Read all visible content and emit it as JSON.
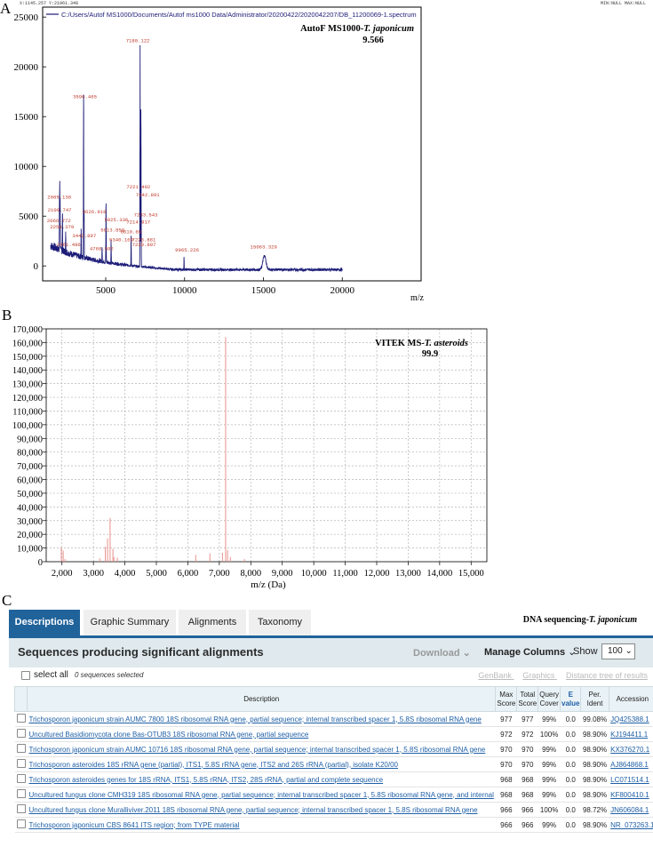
{
  "panels": {
    "a": "A",
    "b": "B",
    "c": "C"
  },
  "chart_data": [
    {
      "type": "line",
      "panel": "A",
      "top_status": {
        "left": "X:1145.257  Y:21961.348",
        "right": "MIN:NULL  MAX:NULL"
      },
      "legend": "C:/Users/Autof MS1000/Documents/Autof ms1000 Data/Administrator/20200422/2020042207/DB_11200069-1.spectrum",
      "annotation": {
        "line1": "AutoF MS1000-",
        "species": "T. japonicum",
        "line2": "9.566"
      },
      "xlabel": "m/z",
      "ylabel": "",
      "xlim": [
        1000,
        25000
      ],
      "ylim": [
        -1500,
        26000
      ],
      "x_ticks": [
        "5000",
        "10000",
        "15000",
        "20000"
      ],
      "y_ticks": [
        "0",
        "5000",
        "10000",
        "15000",
        "20000",
        "25000"
      ],
      "peaks": [
        {
          "label": "2085.138",
          "x": 2085,
          "y": 6500
        },
        {
          "label": "2109.747",
          "x": 2110,
          "y": 5200
        },
        {
          "label": "2066.772",
          "x": 2066,
          "y": 4200
        },
        {
          "label": "2258.379",
          "x": 2258,
          "y": 3600
        },
        {
          "label": "2461.486",
          "x": 2461,
          "y": 1800
        },
        {
          "label": "3442.897",
          "x": 3442,
          "y": 2700
        },
        {
          "label": "3596.465",
          "x": 3596,
          "y": 16600
        },
        {
          "label": "3626.918",
          "x": 3627,
          "y": 5000
        },
        {
          "label": "5025.336",
          "x": 5025,
          "y": 4200
        },
        {
          "label": "5013.859",
          "x": 5013,
          "y": 3200
        },
        {
          "label": "5340.169",
          "x": 5340,
          "y": 2200
        },
        {
          "label": "4768.592",
          "x": 4769,
          "y": 1400
        },
        {
          "label": "6610.69",
          "x": 6610,
          "y": 3000
        },
        {
          "label": "7180.122",
          "x": 7180,
          "y": 22200
        },
        {
          "label": "7221.492",
          "x": 7221,
          "y": 7500
        },
        {
          "label": "7242.891",
          "x": 7243,
          "y": 6700
        },
        {
          "label": "7233.543",
          "x": 7233,
          "y": 4700
        },
        {
          "label": "7214.917",
          "x": 7215,
          "y": 4000
        },
        {
          "label": "7226.881",
          "x": 7227,
          "y": 2200
        },
        {
          "label": "7230.807",
          "x": 7231,
          "y": 1700
        },
        {
          "label": "9965.226",
          "x": 9965,
          "y": 1200
        },
        {
          "label": "15063.329",
          "x": 15063,
          "y": 1400
        }
      ],
      "annotation_labels": [
        "2085.138",
        "2109.747",
        "2066.772",
        "2258.379",
        "2461.486",
        "3442.897",
        "3596.465",
        "3626.918",
        "5025.336",
        "5013.859",
        "5340.169",
        "4768.592",
        "6610.69",
        "7180.122",
        "7221.492",
        "7242.891",
        "7233.543",
        "7214.917",
        "7226.881",
        "7230.807",
        "9965.226",
        "15063.329"
      ],
      "line_color": "#1c1c78",
      "label_color": "#c0392b"
    },
    {
      "type": "bar",
      "panel": "B",
      "annotation": {
        "line1": "VITEK MS-",
        "species": "T. asteroids",
        "line2": "99.9"
      },
      "xlabel": "m/z (Da)",
      "ylabel": "",
      "xlim": [
        1500,
        15500
      ],
      "ylim": [
        0,
        170000
      ],
      "x_ticks": [
        "2,000",
        "3,000",
        "4,000",
        "5,000",
        "6,000",
        "7,000",
        "8,000",
        "9,000",
        "10,000",
        "11,000",
        "12,000",
        "13,000",
        "14,000",
        "15,000"
      ],
      "y_ticks": [
        "0",
        "10,000",
        "20,000",
        "30,000",
        "40,000",
        "50,000",
        "60,000",
        "70,000",
        "80,000",
        "90,000",
        "100,000",
        "110,000",
        "120,000",
        "130,000",
        "140,000",
        "150,000",
        "160,000",
        "170,000"
      ],
      "grid": true,
      "bar_color": "#e8918c",
      "peaks": [
        {
          "x": 1980,
          "y": 10500
        },
        {
          "x": 2040,
          "y": 8000
        },
        {
          "x": 2100,
          "y": 2000
        },
        {
          "x": 3200,
          "y": 2500
        },
        {
          "x": 3380,
          "y": 11000
        },
        {
          "x": 3450,
          "y": 17000
        },
        {
          "x": 3530,
          "y": 32000
        },
        {
          "x": 3620,
          "y": 9500
        },
        {
          "x": 3650,
          "y": 3500
        },
        {
          "x": 3760,
          "y": 3000
        },
        {
          "x": 6250,
          "y": 5000
        },
        {
          "x": 6700,
          "y": 6000
        },
        {
          "x": 7100,
          "y": 6500
        },
        {
          "x": 7200,
          "y": 164000
        },
        {
          "x": 7260,
          "y": 8500
        },
        {
          "x": 7350,
          "y": 3500
        },
        {
          "x": 7800,
          "y": 2000
        }
      ]
    }
  ],
  "blast": {
    "tabs": [
      "Descriptions",
      "Graphic Summary",
      "Alignments",
      "Taxonomy"
    ],
    "title_prefix": "DNA sequencing-",
    "title_species": "T. japonicum",
    "header": "Sequences producing significant alignments",
    "download": "Download",
    "manage": "Manage Columns",
    "show": "Show",
    "show_value": "100",
    "select_all": "select all",
    "selected": "0 sequences selected",
    "links": [
      "GenBank",
      "Graphics",
      "Distance tree of results"
    ],
    "columns": {
      "description": "Description",
      "max_score": [
        "Max",
        "Score"
      ],
      "total_score": [
        "Total",
        "Score"
      ],
      "query_cover": [
        "Query",
        "Cover"
      ],
      "e_value": [
        "E",
        "value"
      ],
      "per_ident": [
        "Per.",
        "Ident"
      ],
      "accession": "Accession"
    },
    "rows": [
      {
        "desc": "Trichosporon japonicum strain AUMC 7800 18S ribosomal RNA gene, partial sequence; internal transcribed spacer 1, 5.8S ribosomal RNA gene",
        "max": "977",
        "total": "977",
        "cover": "99%",
        "evalue": "0.0",
        "ident": "99.08%",
        "acc": "JQ425388.1"
      },
      {
        "desc": "Uncultured Basidiomycota clone Bas-OTUB3 18S ribosomal RNA gene, partial sequence",
        "max": "972",
        "total": "972",
        "cover": "100%",
        "evalue": "0.0",
        "ident": "98.90%",
        "acc": "KJ194411.1"
      },
      {
        "desc": "Trichosporon japonicum strain AUMC 10716 18S ribosomal RNA gene, partial sequence; internal transcribed spacer 1, 5.8S ribosomal RNA gene",
        "max": "970",
        "total": "970",
        "cover": "99%",
        "evalue": "0.0",
        "ident": "98.90%",
        "acc": "KX376270.1"
      },
      {
        "desc": "Trichosporon asteroides 18S rRNA gene (partial), ITS1, 5.8S rRNA gene, ITS2 and 26S rRNA (partial), isolate K20/00",
        "max": "970",
        "total": "970",
        "cover": "99%",
        "evalue": "0.0",
        "ident": "98.90%",
        "acc": "AJ864868.1"
      },
      {
        "desc": "Trichosporon asteroides genes for 18S rRNA, ITS1, 5.8S rRNA, ITS2, 28S rRNA, partial and complete sequence",
        "max": "968",
        "total": "968",
        "cover": "99%",
        "evalue": "0.0",
        "ident": "98.90%",
        "acc": "LC071514.1"
      },
      {
        "desc": "Uncultured fungus clone CMH319 18S ribosomal RNA gene, partial sequence; internal transcribed spacer 1, 5.8S ribosomal RNA gene, and internal",
        "max": "968",
        "total": "968",
        "cover": "99%",
        "evalue": "0.0",
        "ident": "98.90%",
        "acc": "KF800410.1"
      },
      {
        "desc": "Uncultured fungus clone Muralliviver.2011 18S ribosomal RNA gene, partial sequence; internal transcribed spacer 1, 5.8S ribosomal RNA gene",
        "max": "966",
        "total": "966",
        "cover": "100%",
        "evalue": "0.0",
        "ident": "98.72%",
        "acc": "JN606084.1"
      },
      {
        "desc": "Trichosporon japonicum CBS 8641 ITS region; from TYPE material",
        "max": "966",
        "total": "966",
        "cover": "99%",
        "evalue": "0.0",
        "ident": "98.90%",
        "acc": "NR_073263.1"
      }
    ]
  }
}
